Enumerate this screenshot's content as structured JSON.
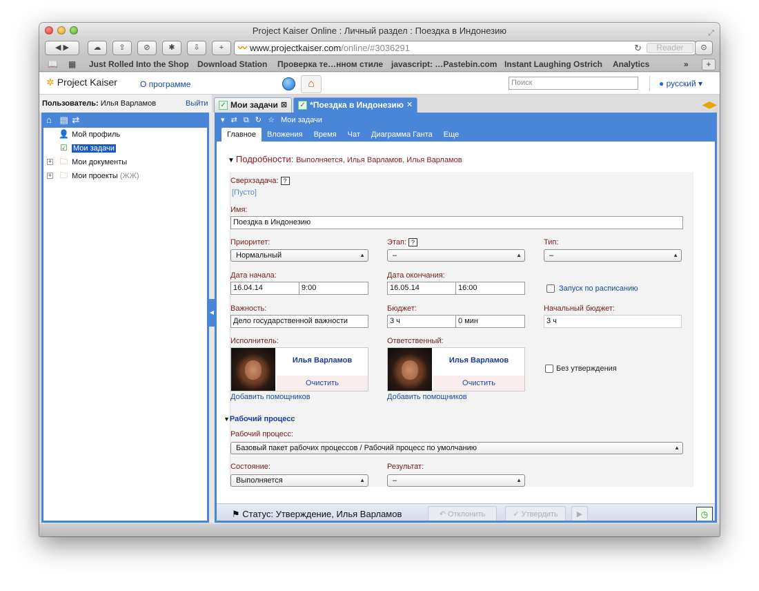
{
  "window": {
    "title": "Project Kaiser Online : Личный раздел : Поездка в Индонезию"
  },
  "browser": {
    "url_host": "www.projectkaiser.com",
    "url_path": "/online/#3036291",
    "reader_label": "Reader",
    "bookmarks": [
      "Just Rolled Into the Shop",
      "Download Station",
      "Проверка те…нном стиле",
      "javascript: …Pastebin.com",
      "Instant Laughing Ostrich",
      "Analytics"
    ],
    "bookmarks_more": "»"
  },
  "app": {
    "logo_text": "Project Kaiser",
    "about_link": "О программе",
    "search_placeholder": "Поиск",
    "language": "русский ▾"
  },
  "user": {
    "label": "Пользователь:",
    "name": "Илья Варламов",
    "logout": "Выйти"
  },
  "tabs": [
    {
      "label": "Мои задачи",
      "active": false
    },
    {
      "label": "*Поездка в Индонезию",
      "active": true
    }
  ],
  "sidebar": {
    "items": [
      {
        "label": "Мой профиль",
        "icon": "person-icon",
        "expandable": false,
        "selected": false
      },
      {
        "label": "Мои задачи",
        "icon": "tasks-icon",
        "expandable": false,
        "selected": true
      },
      {
        "label": "Мои документы",
        "icon": "documents-icon",
        "expandable": true,
        "selected": false
      },
      {
        "label": "Мои проекты",
        "suffix": "(ЖЖ)",
        "icon": "projects-icon",
        "expandable": true,
        "selected": false
      }
    ]
  },
  "main": {
    "toolbar_label": "Мои задачи",
    "subtabs": [
      "Главное",
      "Вложения",
      "Время",
      "Чат",
      "Диаграмма Ганта",
      "Еще"
    ],
    "details": {
      "title": "Подробности:",
      "status": "Выполняется, Илья Варламов, Илья Варламов"
    },
    "form": {
      "parent_task_label": "Сверхзадача:",
      "help": "?",
      "parent_task_value": "[Пусто]",
      "name_label": "Имя:",
      "name_value": "Поездка в Индонезию",
      "priority_label": "Приоритет:",
      "priority_value": "Нормальный",
      "stage_label": "Этап:",
      "stage_value": "–",
      "type_label": "Тип:",
      "type_value": "–",
      "start_label": "Дата начала:",
      "start_date": "16.04.14",
      "start_time": "9:00",
      "end_label": "Дата окончания:",
      "end_date": "16.05.14",
      "end_time": "16:00",
      "schedule_label": "Запуск по расписанию",
      "importance_label": "Важность:",
      "importance_value": "Дело государственной важности",
      "budget_label": "Бюджет:",
      "budget_hours": "3 ч",
      "budget_minutes": "0 мин",
      "initial_budget_label": "Начальный бюджет:",
      "initial_budget_value": "3 ч",
      "assignee_label": "Исполнитель:",
      "assignee_name": "Илья Варламов",
      "responsible_label": "Ответственный:",
      "responsible_name": "Илья Варламов",
      "clear_label": "Очистить",
      "add_helpers": "Добавить помощников",
      "no_approval_label": "Без утверждения",
      "workflow_section": "Рабочий процесс",
      "workflow_label": "Рабочий процесс:",
      "workflow_value": "Базовый пакет рабочих процессов / Рабочий процесс по умолчанию",
      "state_label": "Состояние:",
      "state_value": "Выполняется",
      "result_label": "Результат:",
      "result_value": "–"
    },
    "statusbar": {
      "text": "Статус: Утверждение, Илья Варламов",
      "reject": "Отклонить",
      "approve": "Утвердить"
    }
  },
  "colors": {
    "accent": "#4a86d8",
    "selection": "#1b58c9",
    "label": "#7a1a1a",
    "link": "#1a4aa0"
  }
}
